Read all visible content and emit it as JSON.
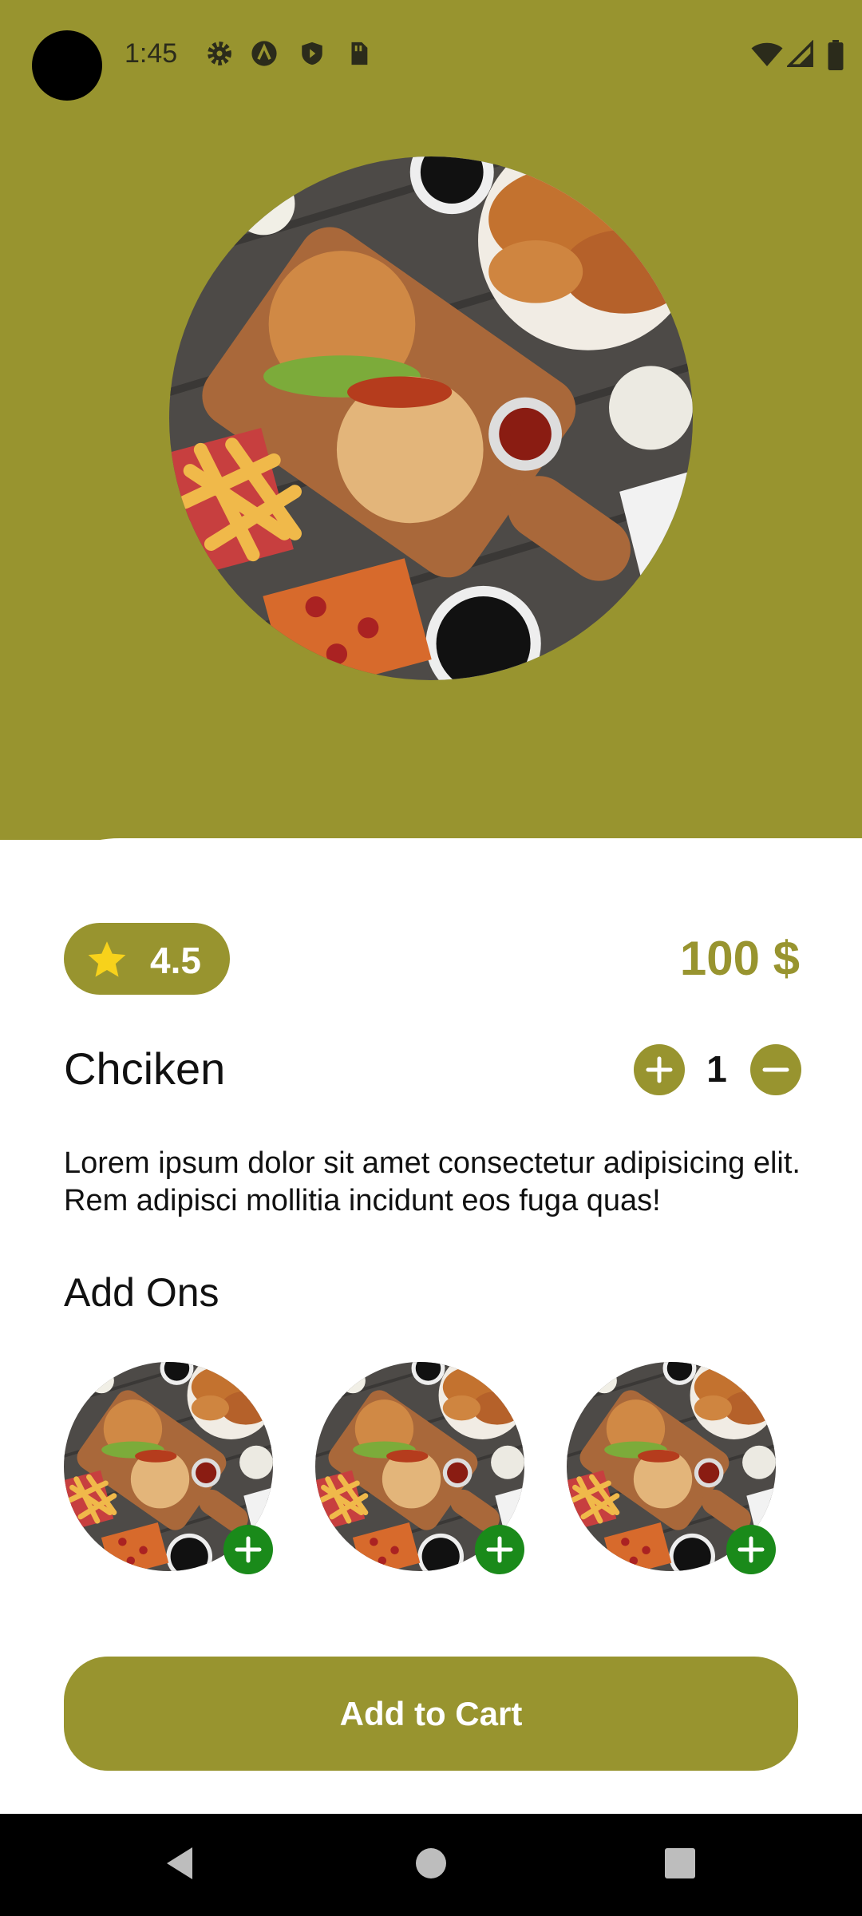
{
  "status_bar": {
    "time": "1:45",
    "icons": [
      "settings-icon",
      "a-badge-icon",
      "shield-icon",
      "sim-card-icon",
      "wifi-icon",
      "signal-icon",
      "battery-icon"
    ]
  },
  "colors": {
    "accent": "#98942f",
    "add_on_plus": "#1a8a1a",
    "star": "#f7d21b",
    "background": "#ffffff"
  },
  "product": {
    "image": "food-platter-photo",
    "rating": "4.5",
    "price": "100 $",
    "name": "Chciken",
    "quantity": "1",
    "description": "Lorem ipsum dolor sit amet consectetur adipisicing elit. Rem adipisci mollitia incidunt eos fuga quas!"
  },
  "add_ons": {
    "title": "Add Ons",
    "items": [
      {
        "image": "food-platter-photo",
        "icon": "plus-icon"
      },
      {
        "image": "food-platter-photo",
        "icon": "plus-icon"
      },
      {
        "image": "food-platter-photo",
        "icon": "plus-icon"
      }
    ]
  },
  "cart_button": {
    "label": "Add to Cart"
  },
  "nav_bar": {
    "icons": [
      "back-icon",
      "home-icon",
      "recents-icon"
    ]
  }
}
